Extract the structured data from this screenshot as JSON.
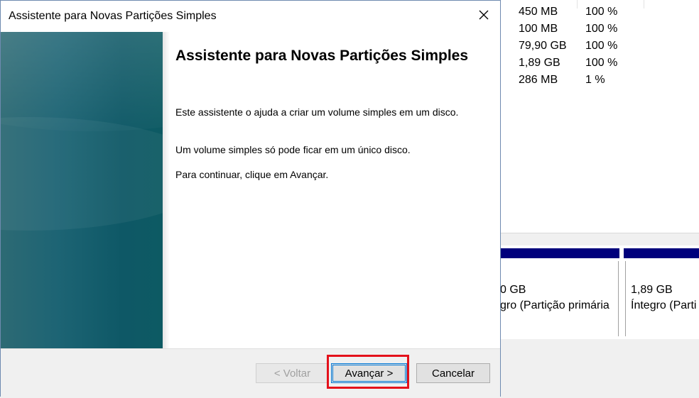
{
  "dialog": {
    "title": "Assistente para Novas Partições Simples",
    "heading": "Assistente para Novas Partições Simples",
    "paragraphs": [
      "Este assistente o ajuda a criar um volume simples em um disco.",
      "Um volume simples só pode ficar em um único disco.",
      "Para continuar, clique em Avançar."
    ],
    "buttons": {
      "back": "< Voltar",
      "next": "Avançar >",
      "cancel": "Cancelar"
    }
  },
  "background": {
    "volume_rows": [
      {
        "size": "450 MB",
        "percent": "100 %"
      },
      {
        "size": "100 MB",
        "percent": "100 %"
      },
      {
        "size": "79,90 GB",
        "percent": "100 %"
      },
      {
        "size": "1,89 GB",
        "percent": "100 %"
      },
      {
        "size": "286 MB",
        "percent": "1 %"
      }
    ],
    "partitions": [
      {
        "line1": "0 GB",
        "line2": "gro (Partição primária"
      },
      {
        "line1": "1,89 GB",
        "line2": "Íntegro (Parti"
      }
    ]
  },
  "colors": {
    "partition_bar": "#00007c",
    "highlight": "#e4111b",
    "side_panel": "#1d6474"
  },
  "icons": {
    "close": "close-icon"
  }
}
